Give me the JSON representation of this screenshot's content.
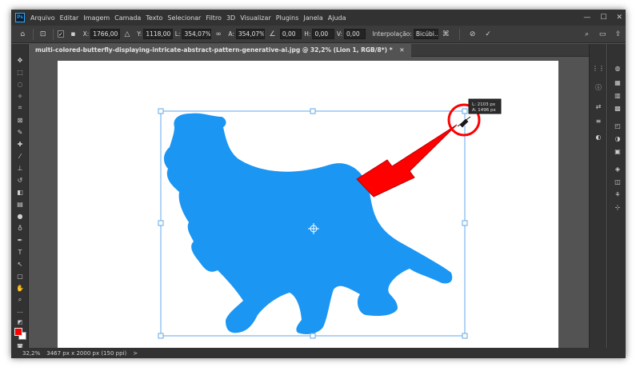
{
  "app": {
    "logo_text": "Ps"
  },
  "menu": [
    "Arquivo",
    "Editar",
    "Imagem",
    "Camada",
    "Texto",
    "Selecionar",
    "Filtro",
    "3D",
    "Visualizar",
    "Plugins",
    "Janela",
    "Ajuda"
  ],
  "window_controls": {
    "minimize": "—",
    "maximize": "☐",
    "close": "✕"
  },
  "options": {
    "x_label": "X:",
    "x_value": "1766,00 p",
    "y_label": "Y:",
    "y_value": "1118,00 p",
    "w_label": "L:",
    "w_value": "354,07%",
    "h_label": "A:",
    "h_value": "354,07%",
    "rotate_value": "0,00",
    "hskew_label": "H:",
    "hskew_value": "0,00",
    "vskew_label": "V:",
    "vskew_value": "0,00",
    "interp_label": "Interpolação:",
    "interp_value": "Bicúbi..."
  },
  "document_tab": "multi-colored-butterfly-displaying-intricate-abstract-pattern-generative-ai.jpg @ 32,2% (Lion 1, RGB/8*) *",
  "tooltip": {
    "line1": "L: 2103 px",
    "line2": "A: 1496 px"
  },
  "status": {
    "zoom": "32,2%",
    "doc_info": "3467 px x 2000 px (150 ppi)",
    "arrow": ">"
  },
  "colors": {
    "foreground": "#ff0000",
    "background": "#ffffff",
    "lion": "#1b96f3",
    "annotation": "#ff0000",
    "bbox": "#62a8e8"
  }
}
